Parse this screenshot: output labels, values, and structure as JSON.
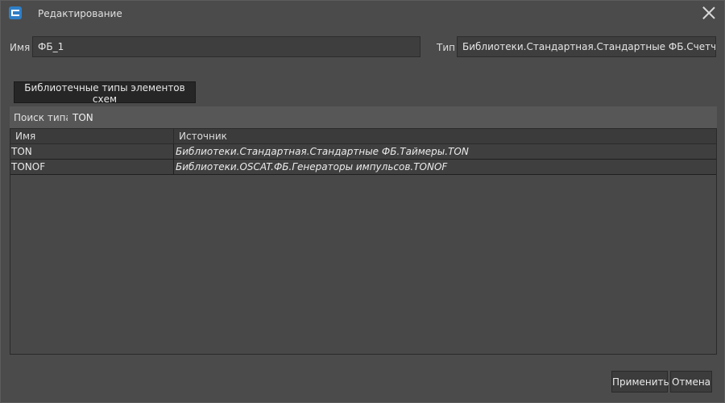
{
  "window": {
    "title": "Редактирование",
    "app_icon": "app-logo-icon",
    "close_icon": "close-icon"
  },
  "form": {
    "name_label": "Имя",
    "name_value": "ФБ_1",
    "type_label": "Тип",
    "type_value": "Библиотеки.Стандартная.Стандартные ФБ.Счетчики.CTU"
  },
  "library_button": {
    "label": "Библиотечные типы элементов схем"
  },
  "search": {
    "label": "Поиск типа",
    "value": "TON"
  },
  "table": {
    "columns": [
      "Имя",
      "Источник"
    ],
    "rows": [
      {
        "name": "TON",
        "source": "Библиотеки.Стандартная.Стандартные ФБ.Таймеры.TON"
      },
      {
        "name": "TONOF",
        "source": "Библиотеки.OSCAT.ФБ.Генераторы импульсов.TONOF"
      }
    ]
  },
  "footer": {
    "apply_label": "Применить",
    "cancel_label": "Отмена"
  },
  "colors": {
    "background": "#4b4b4b",
    "field": "#3e3e3e",
    "button_dark": "#262626",
    "row": "#3f3f3f",
    "accent_icon": "#2f7fc7"
  }
}
